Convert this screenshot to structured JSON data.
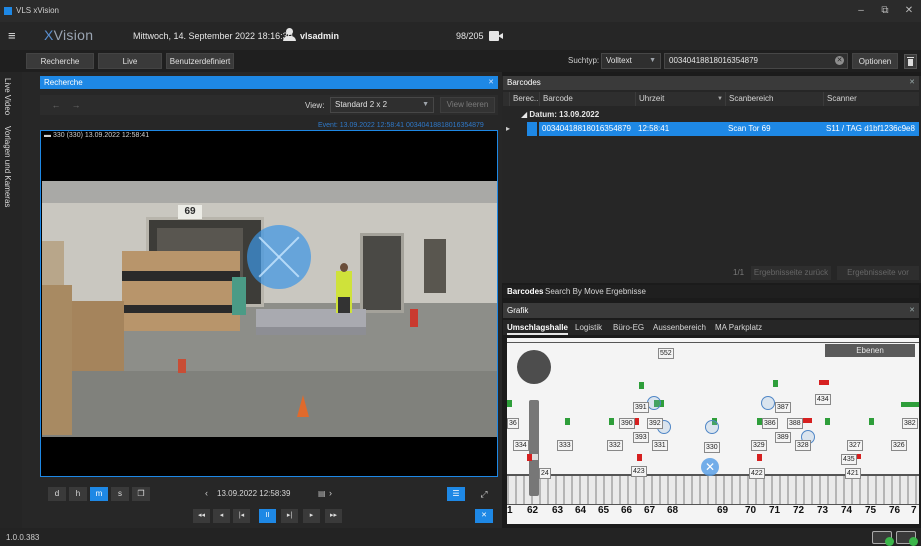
{
  "window": {
    "app_title": "VLS xVision",
    "minimize": "–",
    "maximize": "⧉",
    "close": "✕"
  },
  "header": {
    "brand_x": "X",
    "brand_name": "Vision",
    "datetime": "Mittwoch, 14. September 2022 18:16:30",
    "username": "vlsadmin",
    "counter": "98/205"
  },
  "toolbar": {
    "recherche": "Recherche",
    "live": "Live",
    "benutzerdefiniert": "Benutzerdefiniert",
    "suchtyp_label": "Suchtyp:",
    "suchtyp_value": "Volltext",
    "search_value": "00340418818016354879",
    "optionen": "Optionen"
  },
  "sidebar": {
    "live_video": "Live Video",
    "vorlagen": "Vorlagen und Kameras"
  },
  "recherche": {
    "title": "Recherche",
    "view_label": "View:",
    "view_value": "Standard 2 x 2",
    "view_clear": "View leeren",
    "event": "Event: 13.09.2022 12:58:41 00340418818016354879",
    "video_info": "330 (330)   13.09.2022 12:58:41",
    "scene_sign": "69",
    "time_buttons": [
      "d",
      "h",
      "m",
      "s"
    ],
    "active_time_button": "m",
    "timestamp": "13.09.2022 12:58:39",
    "playback": [
      "◂◂",
      "◂",
      "|◂",
      "II",
      "▸|",
      "▸",
      "▸▸"
    ]
  },
  "barcodes": {
    "title": "Barcodes",
    "columns": [
      "Berec...",
      "Barcode",
      "Uhrzeit",
      "Scanbereich",
      "Scanner"
    ],
    "group": "Datum: 13.09.2022",
    "rows": [
      {
        "barcode": "00340418818016354879",
        "time": "12:58:41",
        "area": "Scan Tor 69",
        "scanner": "S11 / TAG d1bf1236c9e8"
      }
    ],
    "page": "1/1",
    "prev_page": "Ergebnisseite zurück",
    "next_page": "Ergebnisseite vor",
    "tabs": [
      "Barcodes",
      "Search By Move Ergebnisse"
    ]
  },
  "grafik": {
    "title": "Grafik",
    "tabs": [
      "Umschlagshalle",
      "Logistik",
      "Büro-EG",
      "Aussenbereich",
      "MA Parkplatz"
    ],
    "ebenen": "Ebenen",
    "labels": [
      {
        "t": "552"
      },
      {
        "t": "434"
      },
      {
        "t": "391"
      },
      {
        "t": "387"
      },
      {
        "t": "390"
      },
      {
        "t": "392"
      },
      {
        "t": "386"
      },
      {
        "t": "388"
      },
      {
        "t": "393"
      },
      {
        "t": "389"
      },
      {
        "t": "382"
      },
      {
        "t": "334"
      },
      {
        "t": "333"
      },
      {
        "t": "332"
      },
      {
        "t": "331"
      },
      {
        "t": "330"
      },
      {
        "t": "329"
      },
      {
        "t": "328"
      },
      {
        "t": "327"
      },
      {
        "t": "326"
      },
      {
        "t": "435"
      },
      {
        "t": "36"
      },
      {
        "t": "24"
      },
      {
        "t": "423"
      },
      {
        "t": "422"
      },
      {
        "t": "421"
      }
    ],
    "gate_numbers": [
      "1",
      "62",
      "63",
      "64",
      "65",
      "66",
      "67",
      "68",
      "69",
      "70",
      "71",
      "72",
      "73",
      "74",
      "75",
      "76",
      "7"
    ]
  },
  "status": {
    "version": "1.0.0.383"
  }
}
